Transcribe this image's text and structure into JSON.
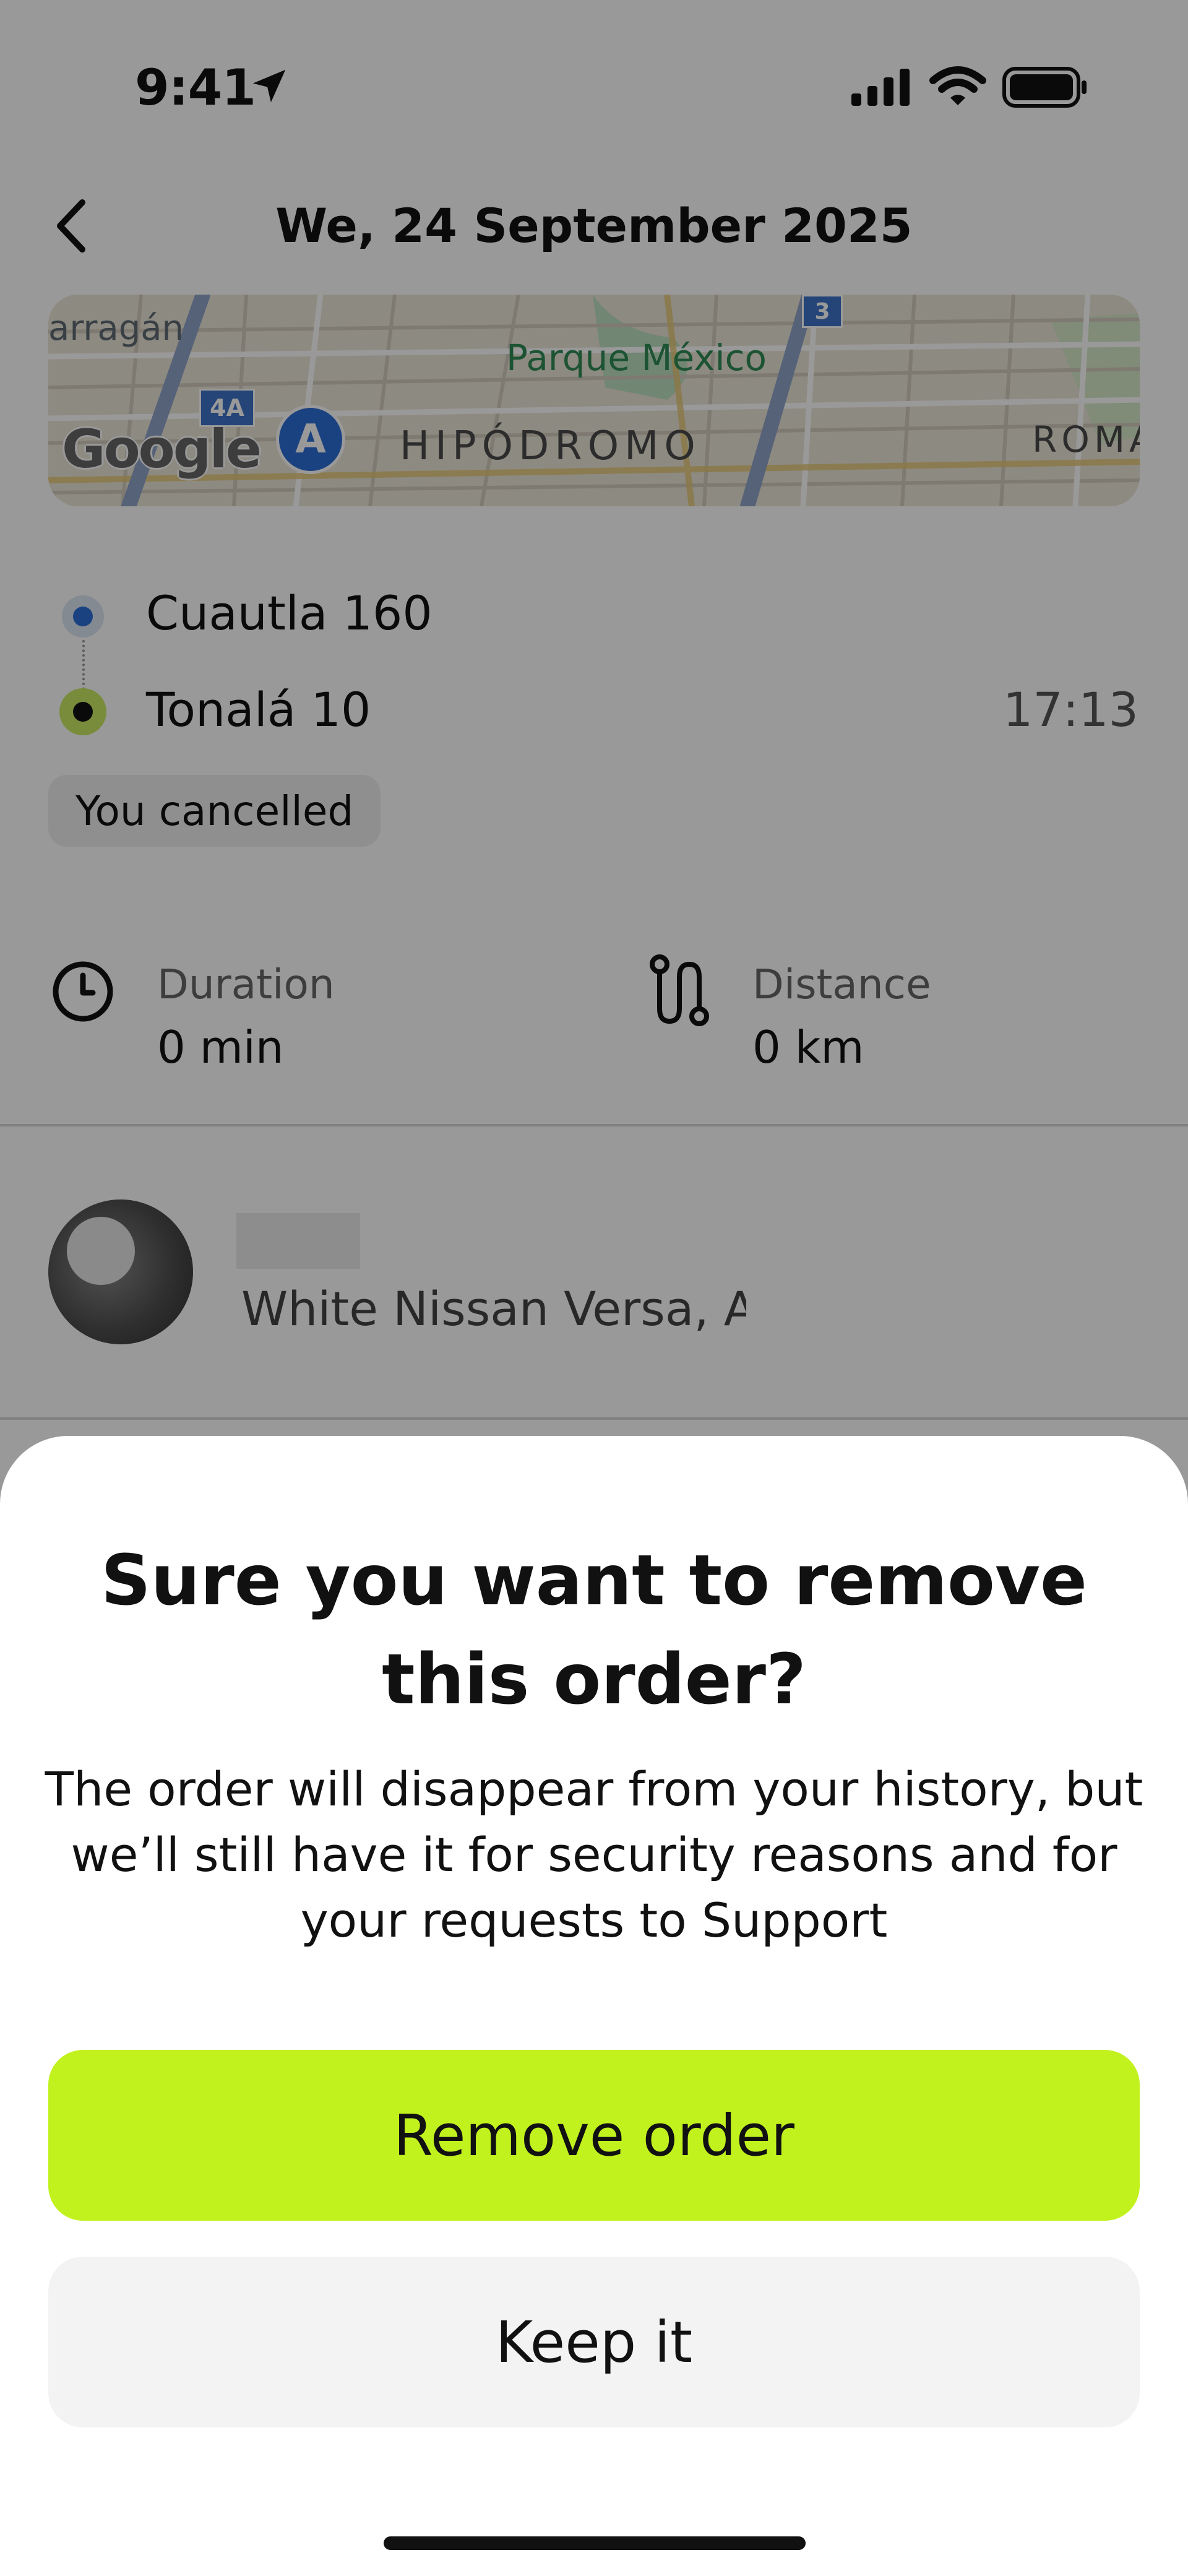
{
  "status_bar": {
    "time": "9:41"
  },
  "header": {
    "title": "We, 24 September 2025"
  },
  "map": {
    "labels": {
      "arragan": "arragán",
      "parque": "Parque México",
      "hipodromo": "HIPÓDROMO",
      "roma": "ROMA",
      "google": "Google"
    },
    "shields": {
      "a": "4A",
      "b": "3"
    },
    "marker": "A"
  },
  "route": {
    "origin": "Cuautla 160",
    "destination": "Tonalá 10",
    "destination_time": "17:13",
    "status": "You cancelled"
  },
  "stats": {
    "duration_label": "Duration",
    "duration_value": "0 min",
    "distance_label": "Distance",
    "distance_value": "0 km"
  },
  "driver": {
    "car": "White Nissan Versa, A"
  },
  "dialog": {
    "title": "Sure you want to remove this order?",
    "description": "The order will disappear from your history, but we’ll still have it for security reasons and for your requests to Support",
    "confirm_label": "Remove order",
    "cancel_label": "Keep it"
  },
  "colors": {
    "accent": "#c2f21e",
    "overlay": "rgba(0,0,0,0.40)",
    "origin_dot": "#2e6ed6",
    "destination_ring": "#c9ea63"
  },
  "icons": {
    "back": "chevron-left-icon",
    "location": "location-arrow-icon",
    "signal": "cellular-signal-icon",
    "wifi": "wifi-icon",
    "battery": "battery-icon",
    "duration": "clock-icon",
    "distance": "route-icon"
  }
}
